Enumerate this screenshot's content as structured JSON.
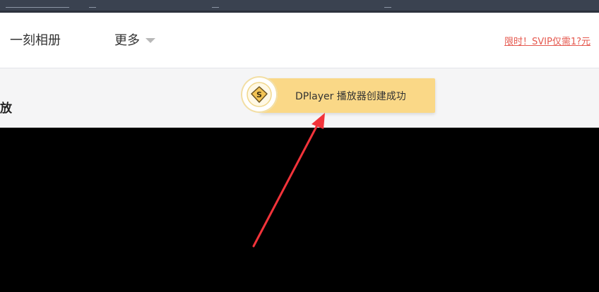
{
  "nav": {
    "items": [
      {
        "label": "一刻相册"
      },
      {
        "label": "更多"
      }
    ],
    "promo": "限时！SVIP仅需1?元"
  },
  "page": {
    "title_partial": "放"
  },
  "toast": {
    "message": "DPlayer 播放器创建成功",
    "badge_letter": "S"
  },
  "colors": {
    "toast_bg": "#fad887",
    "promo_text": "#e5584e",
    "arrow": "#f2333a",
    "player_bg": "#000000"
  }
}
